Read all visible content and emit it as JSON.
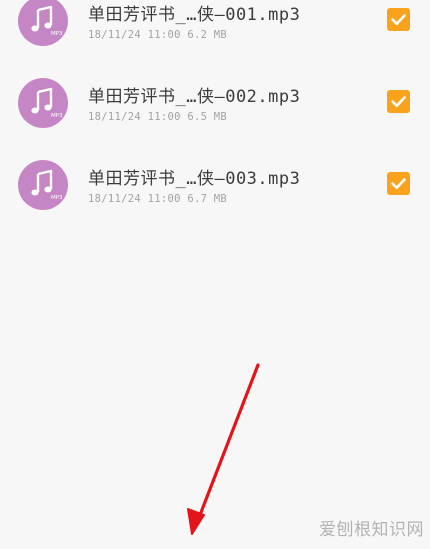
{
  "colors": {
    "background": "#f7f7f7",
    "icon_bg": "#c586c6",
    "checkbox": "#f9a21c",
    "arrow": "#e3151a"
  },
  "files": [
    {
      "name": "单田芳评书_…侠—001.mp3",
      "meta": "18/11/24 11:00 6.2 MB",
      "icon": "music-note-icon",
      "icon_badge": "MP3",
      "checked": true
    },
    {
      "name": "单田芳评书_…侠—002.mp3",
      "meta": "18/11/24 11:00 6.5 MB",
      "icon": "music-note-icon",
      "icon_badge": "MP3",
      "checked": true
    },
    {
      "name": "单田芳评书_…侠—003.mp3",
      "meta": "18/11/24 11:00 6.7 MB",
      "icon": "music-note-icon",
      "icon_badge": "MP3",
      "checked": true
    }
  ],
  "watermark": "爱刨根知识网"
}
